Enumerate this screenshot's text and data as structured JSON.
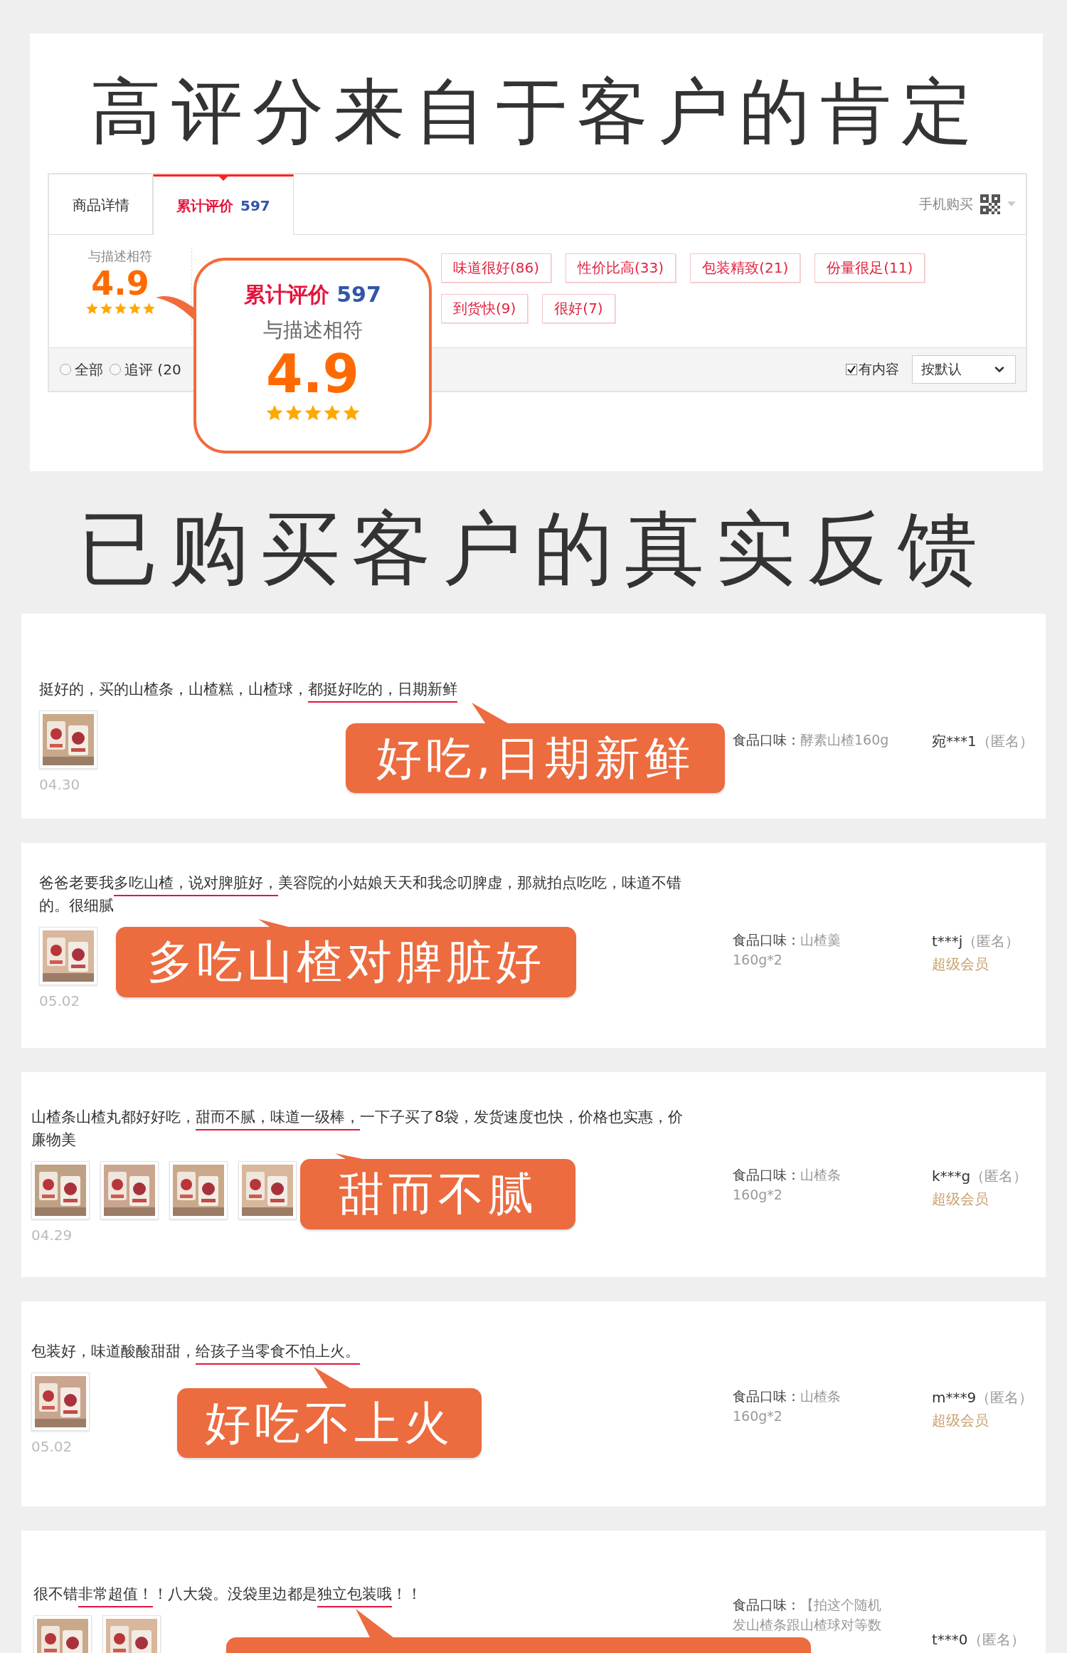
{
  "headline": "高评分来自于客户的肯定",
  "review_panel": {
    "tabs": [
      {
        "label": "商品详情",
        "selected": false
      },
      {
        "label": "累计评价",
        "count": "597",
        "selected": true
      }
    ],
    "mobile_buy": "手机购买",
    "rating": {
      "label": "与描述相符",
      "score": "4.9",
      "stars": 5
    },
    "tags": [
      "味道很好(86)",
      "性价比高(33)",
      "包装精致(21)",
      "份量很足(11)",
      "到货快(9)",
      "很好(7)"
    ],
    "filters": [
      {
        "label": "全部",
        "selected": false
      },
      {
        "label": "追评 (20",
        "selected": false
      }
    ],
    "content_filter": {
      "label": "有内容",
      "checked": true
    },
    "sort": {
      "value": "按默认"
    }
  },
  "callout": {
    "title": "累计评价",
    "count": "597",
    "label": "与描述相符",
    "score": "4.9",
    "stars": 5
  },
  "section_title": "已购买客户的真实反馈",
  "reviews": [
    {
      "segments": [
        {
          "text": "挺好的，买的山楂条，山楂糕，山楂球，",
          "underlined": false
        },
        {
          "text": "都挺好吃的，日期新鲜",
          "underlined": true
        }
      ],
      "photos": [
        {
          "kind": "picture"
        }
      ],
      "date": "04.30",
      "flavor_label": "食品口味：",
      "flavor": "酵素山楂160g",
      "user": "宛***1",
      "anonymous": "（匿名）",
      "callout": "好吃,日期新鲜"
    },
    {
      "segments": [
        {
          "text": "爸爸老要我",
          "underlined": false
        },
        {
          "text": "多吃山楂，说对脾脏好，",
          "underlined": true
        },
        {
          "text": "美容院的小姑娘天天和我念叨脾虚，那就拍点吃吃，味道不错的。很细腻",
          "underlined": false
        }
      ],
      "photos": [
        {
          "kind": "picture"
        }
      ],
      "date": "05.02",
      "flavor_label": "食品口味：",
      "flavor": "山楂羹160g*2",
      "user": "t***j",
      "anonymous": "（匿名）",
      "badge": "超级会员",
      "callout": "多吃山楂对脾脏好"
    },
    {
      "segments": [
        {
          "text": "山楂条山楂丸都好好吃，",
          "underlined": false
        },
        {
          "text": "甜而不腻，味道一级棒，",
          "underlined": true
        },
        {
          "text": "一下子买了8袋，发货速度也快，价格也实惠，价廉物美",
          "underlined": false
        }
      ],
      "photos": [
        {
          "kind": "picture"
        },
        {
          "kind": "picture"
        },
        {
          "kind": "picture"
        },
        {
          "kind": "picture"
        }
      ],
      "date": "04.29",
      "flavor_label": "食品口味：",
      "flavor": "山楂条160g*2",
      "user": "k***g",
      "anonymous": "（匿名）",
      "badge": "超级会员",
      "callout": "甜而不腻"
    },
    {
      "segments": [
        {
          "text": "包装好，味道酸酸甜甜，",
          "underlined": false
        },
        {
          "text": "给孩子当零食不怕上火。",
          "underlined": true
        }
      ],
      "photos": [
        {
          "kind": "picture"
        }
      ],
      "date": "05.02",
      "flavor_label": "食品口味：",
      "flavor": "山楂条160g*2",
      "user": "m***9",
      "anonymous": "（匿名）",
      "badge": "超级会员",
      "callout": "好吃不上火"
    },
    {
      "segments": [
        {
          "text": "很不错",
          "underlined": false
        },
        {
          "text": "非常超值！",
          "underlined": true
        },
        {
          "text": "！八大袋。没袋里边都是",
          "underlined": false
        },
        {
          "text": "独立包装哦",
          "underlined": true
        },
        {
          "text": "！！",
          "underlined": false
        }
      ],
      "photos": [
        {
          "kind": "picture"
        },
        {
          "kind": "picture"
        }
      ],
      "flavor_label": "食品口味：",
      "flavor": "【拍这个随机发山楂条跟山楂球对等数",
      "user": "t***0",
      "anonymous": "（匿名）"
    }
  ]
}
